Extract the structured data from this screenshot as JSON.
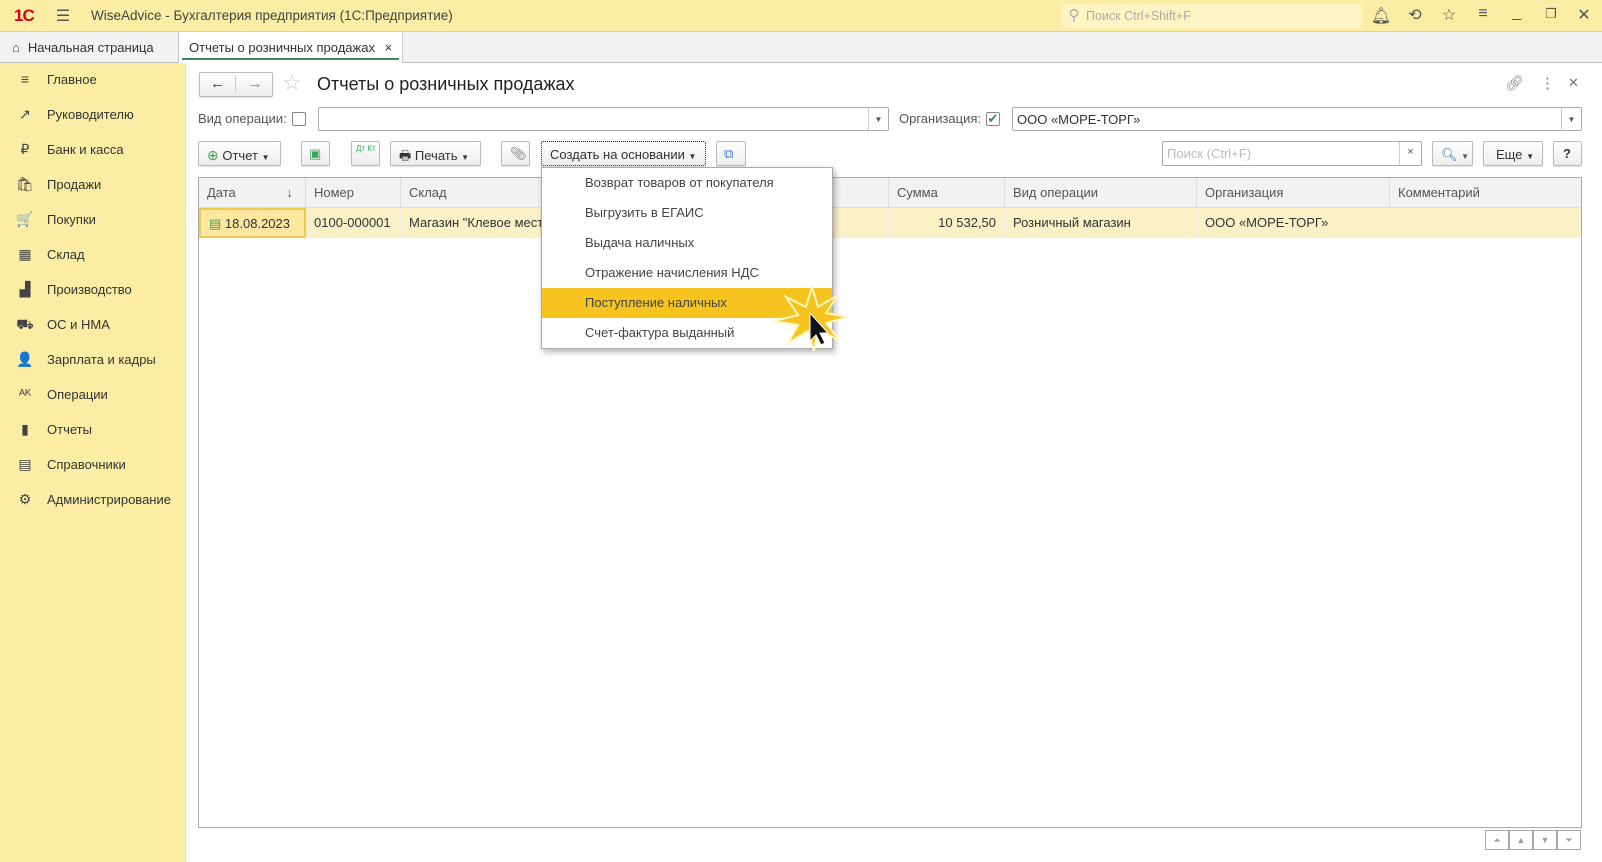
{
  "titlebar": {
    "logo": "1С",
    "title": "WiseAdvice - Бухгалтерия предприятия  (1С:Предприятие)",
    "search_placeholder": "Поиск Ctrl+Shift+F"
  },
  "tabs": [
    {
      "label": "Начальная страница"
    },
    {
      "label": "Отчеты о розничных продажах",
      "close": "×"
    }
  ],
  "sidebar": {
    "items": [
      {
        "label": "Главное",
        "icon": "≡"
      },
      {
        "label": "Руководителю",
        "icon": "↗"
      },
      {
        "label": "Банк и касса",
        "icon": "₽"
      },
      {
        "label": "Продажи",
        "icon": "🛍"
      },
      {
        "label": "Покупки",
        "icon": "🛒"
      },
      {
        "label": "Склад",
        "icon": "▦"
      },
      {
        "label": "Производство",
        "icon": "▟"
      },
      {
        "label": "ОС и НМА",
        "icon": "⛟"
      },
      {
        "label": "Зарплата и кадры",
        "icon": "👤"
      },
      {
        "label": "Операции",
        "icon": "ᴬᴷ"
      },
      {
        "label": "Отчеты",
        "icon": "▮"
      },
      {
        "label": "Справочники",
        "icon": "▤"
      },
      {
        "label": "Администрирование",
        "icon": "⚙"
      }
    ]
  },
  "form": {
    "title": "Отчеты о розничных продажах",
    "filter_op_label": "Вид операции:",
    "filter_op_value": "",
    "org_label": "Организация:",
    "org_value": "ООО «МОРЕ-ТОРГ»",
    "toolbar": {
      "report": "Отчет",
      "print": "Печать",
      "create_based": "Создать на основании",
      "search_placeholder": "Поиск (Ctrl+F)",
      "more": "Еще",
      "help": "?",
      "dtkt": "Дт Кт"
    }
  },
  "table": {
    "columns": [
      "Дата",
      "Номер",
      "Склад",
      "Сумма",
      "Вид операции",
      "Организация",
      "Комментарий"
    ],
    "rows": [
      {
        "date": "18.08.2023",
        "number": "0100-000001",
        "warehouse": "Магазин \"Клевое место\"",
        "sum": "10 532,50",
        "op": "Розничный магазин",
        "org": "ООО «МОРЕ-ТОРГ»",
        "comment": ""
      }
    ]
  },
  "menu": {
    "items": [
      "Возврат товаров от покупателя",
      "Выгрузить в ЕГАИС",
      "Выдача наличных",
      "Отражение начисления НДС",
      "Поступление наличных",
      "Счет-фактура выданный"
    ],
    "highlighted_index": 4
  },
  "colors": {
    "accent": "#fbeda3",
    "highlight": "#f6c31f",
    "row": "#fbf1c7"
  }
}
